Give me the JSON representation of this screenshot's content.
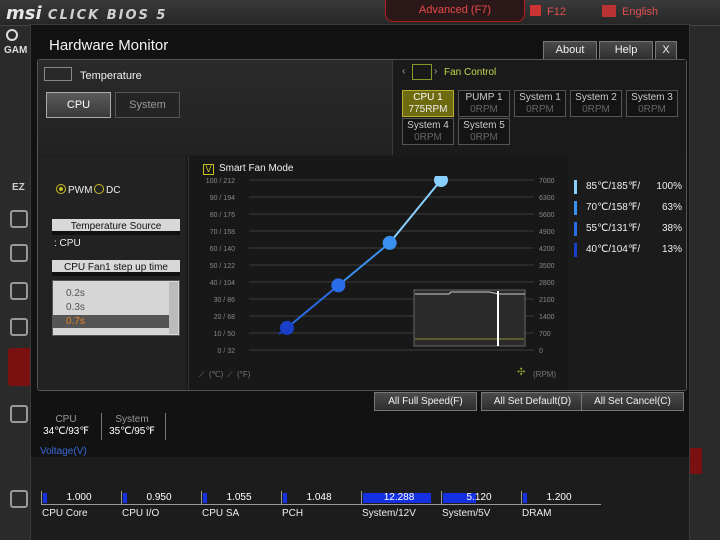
{
  "topbar": {
    "logo_brand": "msi",
    "logo_text": "CLICK BIOS 5",
    "advanced_tab": "Advanced (F7)",
    "f12": "F12",
    "language": "English",
    "game_label": "GAM",
    "ez_label": "EZ"
  },
  "dialog": {
    "title": "Hardware Monitor",
    "buttons": {
      "about": "About",
      "help": "Help",
      "close": "X"
    }
  },
  "temperature": {
    "label": "Temperature",
    "tabs": [
      {
        "label": "CPU",
        "selected": true
      },
      {
        "label": "System",
        "selected": false
      }
    ]
  },
  "fan_control": {
    "label": "Fan Control",
    "fans": [
      {
        "name": "CPU 1",
        "rpm": "775RPM",
        "selected": true
      },
      {
        "name": "PUMP 1",
        "rpm": "0RPM",
        "selected": false
      },
      {
        "name": "System 1",
        "rpm": "0RPM",
        "selected": false
      },
      {
        "name": "System 2",
        "rpm": "0RPM",
        "selected": false
      },
      {
        "name": "System 3",
        "rpm": "0RPM",
        "selected": false
      },
      {
        "name": "System 4",
        "rpm": "0RPM",
        "selected": false
      },
      {
        "name": "System 5",
        "rpm": "0RPM",
        "selected": false
      }
    ]
  },
  "mode": {
    "pwm": "PWM",
    "dc": "DC",
    "selected": "PWM"
  },
  "temp_source": {
    "header": "Temperature Source",
    "value": ": CPU"
  },
  "step_up": {
    "header": "CPU Fan1 step up time",
    "options": [
      {
        "label": "0.2s",
        "selected": false
      },
      {
        "label": "0.3s",
        "selected": false
      },
      {
        "label": "0.7s",
        "selected": true
      }
    ]
  },
  "smart_fan": {
    "label": "Smart Fan Mode",
    "checked": true,
    "check_glyph": "V"
  },
  "graph": {
    "left_ticks": [
      "100 / 212",
      "90 / 194",
      "80 / 176",
      "70 / 158",
      "60 / 140",
      "50 / 122",
      "40 / 104",
      "30 / 86",
      "20 / 68",
      "10 / 50",
      "0 / 32"
    ],
    "right_ticks": [
      "7000",
      "6300",
      "5600",
      "4900",
      "4200",
      "3500",
      "2800",
      "2100",
      "1400",
      "700",
      "0"
    ],
    "points": [
      {
        "temp_c": 40,
        "duty": 13
      },
      {
        "temp_c": 55,
        "duty": 38
      },
      {
        "temp_c": 70,
        "duty": 63
      },
      {
        "temp_c": 85,
        "duty": 100
      }
    ],
    "point_colors": [
      "#1a3fc8",
      "#2a6be8",
      "#3a90ee",
      "#8ad0ff"
    ],
    "unit_c": "(℃)",
    "unit_f": "(°F)",
    "unit_rpm": "(RPM)",
    "mini_history": {
      "label": "realtime fan history",
      "level": 0.75
    }
  },
  "legend": [
    {
      "temp": "85℃/185℉/",
      "pct": "100%",
      "color": "#8ad0ff"
    },
    {
      "temp": "70℃/158℉/",
      "pct": "63%",
      "color": "#3a90ee"
    },
    {
      "temp": "55℃/131℉/",
      "pct": "38%",
      "color": "#2a6be8"
    },
    {
      "temp": "40℃/104℉/",
      "pct": "13%",
      "color": "#1a3fc8"
    }
  ],
  "actions": {
    "full_speed": "All Full Speed(F)",
    "set_default": "All Set Default(D)",
    "set_cancel": "All Set Cancel(C)"
  },
  "temps": [
    {
      "name": "CPU",
      "value": "34℃/93℉"
    },
    {
      "name": "System",
      "value": "35℃/95℉"
    }
  ],
  "voltage": {
    "label": "Voltage(V)",
    "rails": [
      {
        "name": "CPU Core",
        "value": "1.000",
        "fill": 0.06
      },
      {
        "name": "CPU I/O",
        "value": "0.950",
        "fill": 0.06
      },
      {
        "name": "CPU SA",
        "value": "1.055",
        "fill": 0.06
      },
      {
        "name": "PCH",
        "value": "1.048",
        "fill": 0.06
      },
      {
        "name": "System/12V",
        "value": "12.288",
        "fill": 0.92
      },
      {
        "name": "System/5V",
        "value": "5.120",
        "fill": 0.45
      },
      {
        "name": "DRAM",
        "value": "1.200",
        "fill": 0.06
      }
    ]
  }
}
